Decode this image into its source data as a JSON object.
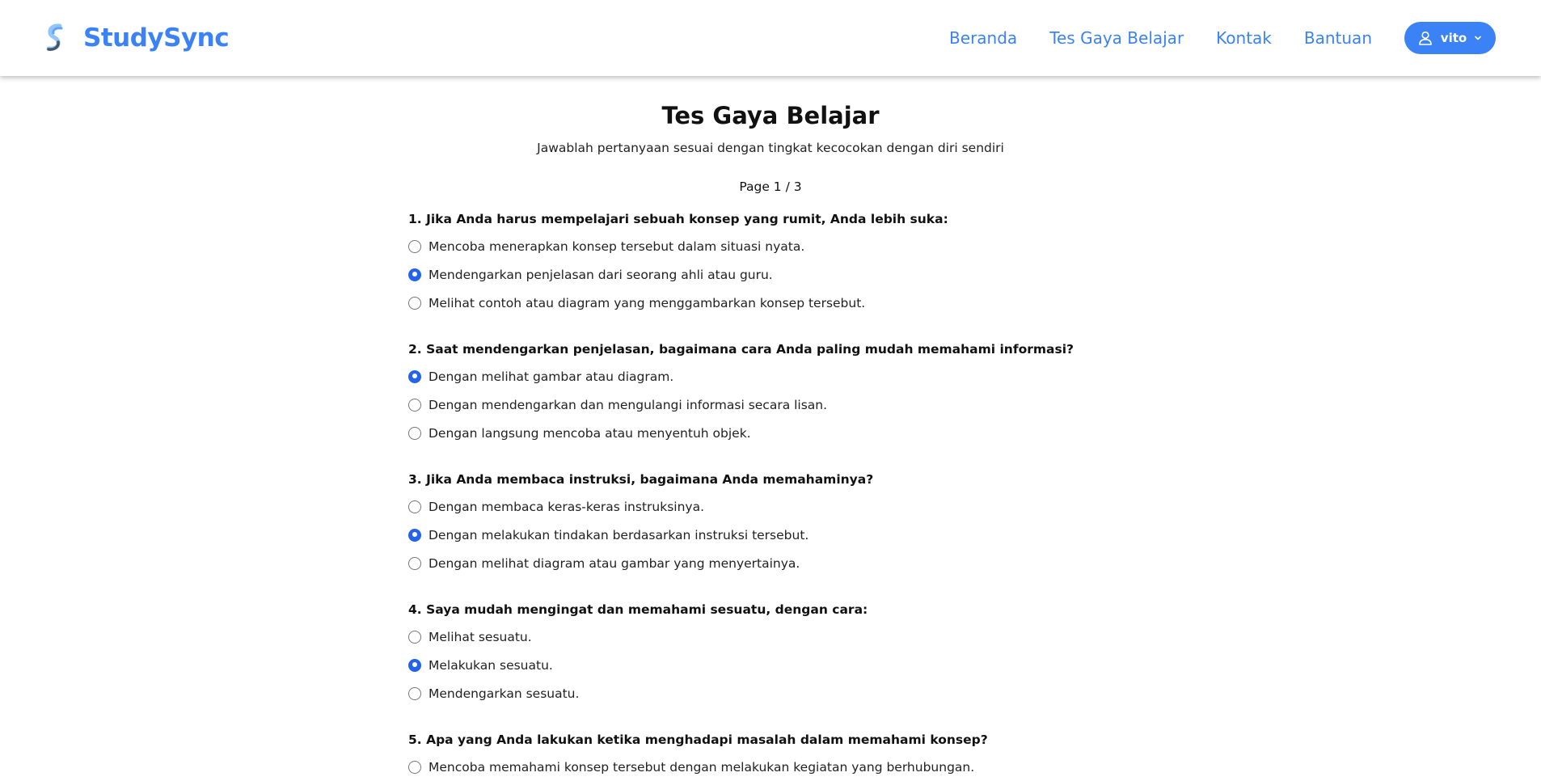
{
  "header": {
    "brand": "StudySync",
    "nav": [
      "Beranda",
      "Tes Gaya Belajar",
      "Kontak",
      "Bantuan"
    ],
    "user": {
      "name": "vito",
      "icon": "user-icon",
      "dropdown_icon": "chevron-down-icon"
    }
  },
  "colors": {
    "accent": "#3b82f6",
    "radio_checked": "#2563eb"
  },
  "main": {
    "title": "Tes Gaya Belajar",
    "subtitle": "Jawablah pertanyaan sesuai dengan tingkat kecocokan dengan diri sendiri",
    "page_indicator": "Page 1 / 3",
    "questions": [
      {
        "text": "1. Jika Anda harus mempelajari sebuah konsep yang rumit, Anda lebih suka:",
        "options": [
          "Mencoba menerapkan konsep tersebut dalam situasi nyata.",
          "Mendengarkan penjelasan dari seorang ahli atau guru.",
          "Melihat contoh atau diagram yang menggambarkan konsep tersebut."
        ],
        "selected": 1
      },
      {
        "text": "2. Saat mendengarkan penjelasan, bagaimana cara Anda paling mudah memahami informasi?",
        "options": [
          "Dengan melihat gambar atau diagram.",
          "Dengan mendengarkan dan mengulangi informasi secara lisan.",
          "Dengan langsung mencoba atau menyentuh objek."
        ],
        "selected": 0
      },
      {
        "text": "3. Jika Anda membaca instruksi, bagaimana Anda memahaminya?",
        "options": [
          "Dengan membaca keras-keras instruksinya.",
          "Dengan melakukan tindakan berdasarkan instruksi tersebut.",
          "Dengan melihat diagram atau gambar yang menyertainya."
        ],
        "selected": 1
      },
      {
        "text": "4. Saya mudah mengingat dan memahami sesuatu, dengan cara:",
        "options": [
          "Melihat sesuatu.",
          "Melakukan sesuatu.",
          "Mendengarkan sesuatu."
        ],
        "selected": 1
      },
      {
        "text": "5. Apa yang Anda lakukan ketika menghadapi masalah dalam memahami konsep?",
        "options": [
          "Mencoba memahami konsep tersebut dengan melakukan kegiatan yang berhubungan."
        ],
        "selected": null
      }
    ]
  }
}
